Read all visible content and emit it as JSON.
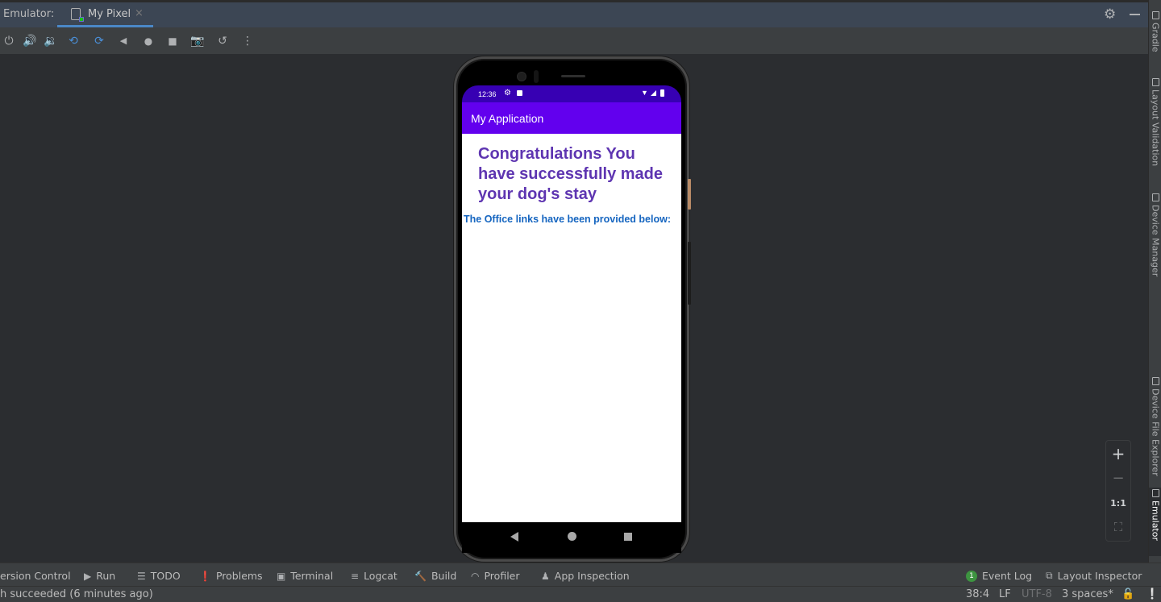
{
  "titlebar": {
    "label": "Emulator:",
    "tab": {
      "label": "My Pixel",
      "close": "×"
    },
    "icons": [
      "gear-icon",
      "minimize-icon"
    ]
  },
  "toolbar": {
    "buttons": [
      {
        "name": "power",
        "glyph": "⏻"
      },
      {
        "name": "volume-up",
        "glyph": "🔊"
      },
      {
        "name": "volume-down",
        "glyph": "🔉"
      },
      {
        "name": "rotate-left",
        "glyph": "⟲"
      },
      {
        "name": "rotate-right",
        "glyph": "⟳"
      },
      {
        "name": "back",
        "glyph": "◀"
      },
      {
        "name": "home",
        "glyph": "●"
      },
      {
        "name": "overview",
        "glyph": "■"
      },
      {
        "name": "screenshot",
        "glyph": "📷"
      },
      {
        "name": "snapshot",
        "glyph": "↺"
      },
      {
        "name": "more",
        "glyph": "⋮"
      }
    ]
  },
  "right_strip": {
    "tabs": [
      "Gradle",
      "Layout Validation",
      "Device Manager",
      "Device File Explorer",
      "Emulator"
    ]
  },
  "zoom_controls": {
    "zoom_in": "+",
    "zoom_out": "−",
    "actual_size": "1:1",
    "fit": "⛶"
  },
  "device": {
    "status_bar": {
      "time": "12:36"
    },
    "app_title": "My Application",
    "headline": "Congratulations You have successfully made your dog's stay",
    "subline": "The Office links have been provided below:",
    "colors": {
      "status_bar": "#3700b3",
      "app_bar": "#6200ee",
      "headline": "#5e35b1",
      "subline": "#1565c0"
    }
  },
  "tool_windows": [
    {
      "label": "ersion Control",
      "icon": ""
    },
    {
      "label": "Run",
      "icon": "▶"
    },
    {
      "label": "TODO",
      "icon": "☰"
    },
    {
      "label": "Problems",
      "icon": "❗"
    },
    {
      "label": "Terminal",
      "icon": "▣"
    },
    {
      "label": "Logcat",
      "icon": "≡"
    },
    {
      "label": "Build",
      "icon": "🔨"
    },
    {
      "label": "Profiler",
      "icon": "◠"
    },
    {
      "label": "App Inspection",
      "icon": "♟"
    },
    {
      "label": "Event Log",
      "badge": "1"
    },
    {
      "label": "Layout Inspector",
      "icon": "⧉"
    }
  ],
  "status_line": {
    "message": "h succeeded (6 minutes ago)",
    "position": "38:4",
    "line_sep": "LF",
    "encoding": "UTF-8",
    "indent": "3 spaces*"
  }
}
